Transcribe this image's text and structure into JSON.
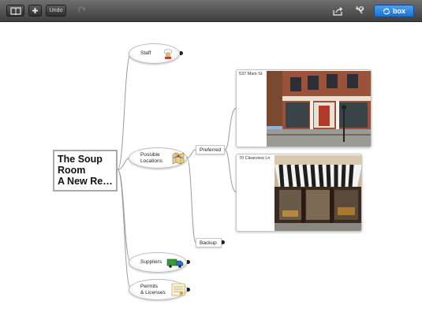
{
  "toolbar": {
    "undo_label": "Undo",
    "box_label": "box"
  },
  "root": {
    "lines": [
      "The Soup",
      "Room",
      "A New Re…"
    ]
  },
  "nodes": {
    "staff": "Staff",
    "possible_locations_line1": "Possible",
    "possible_locations_line2": "Locations",
    "suppliers": "Suppliers",
    "permits_line1": "Permits",
    "permits_line2": "& Licenses",
    "preferred": "Preferred",
    "backup": "Backup"
  },
  "locations": [
    {
      "address": "537 Main St"
    },
    {
      "address": "70 Clearview Ln"
    }
  ],
  "colors": {
    "toolbar": "#4a4a4a",
    "accent": "#1c6fd0"
  }
}
